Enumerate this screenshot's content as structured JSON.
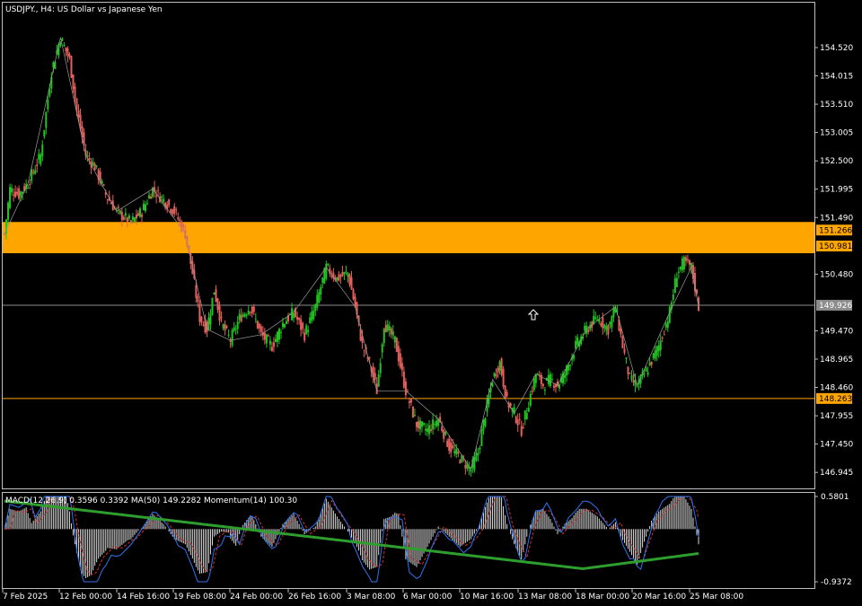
{
  "chart_title": "USDJPY., H4:  US Dollar vs Japanese Yen",
  "indicator_label": "MACD(12,26,9) 0.3596 0.3392 MA(50) 149.2282 Momentum(14) 100.30",
  "colors": {
    "background": "#000000",
    "bull": "#22c322",
    "bear": "#e5605c",
    "zone": "#ffa500",
    "macd_line": "#2f74f0",
    "signal_line": "#d43030",
    "ma_line": "#2e9e2e",
    "hist": "#d8d8d8"
  },
  "price_axis": {
    "ticks": [
      "154.520",
      "154.015",
      "153.510",
      "153.005",
      "152.500",
      "151.995",
      "151.490",
      "150.480",
      "149.470",
      "148.965",
      "148.460",
      "147.955",
      "147.450",
      "146.945"
    ],
    "tick_values": [
      154.52,
      154.015,
      153.51,
      153.005,
      152.5,
      151.995,
      151.49,
      150.48,
      149.47,
      148.965,
      148.46,
      147.955,
      147.45,
      146.945
    ],
    "range": [
      146.66,
      155.32
    ]
  },
  "levels": [
    {
      "label": "151.266",
      "value": 151.266,
      "style": "tag"
    },
    {
      "label": "150.981",
      "value": 150.981,
      "style": "tag"
    },
    {
      "label": "149.926",
      "value": 149.926,
      "style": "current"
    },
    {
      "label": "148.263",
      "value": 148.263,
      "style": "tag-line"
    }
  ],
  "zone": {
    "from": 150.981,
    "to": 151.266
  },
  "indicator_axis": {
    "top_label": "0.5801",
    "bottom_label": "-0.9372"
  },
  "time_axis": [
    "7 Feb 2025",
    "12 Feb 00:00",
    "14 Feb 16:00",
    "19 Feb 08:00",
    "24 Feb 00:00",
    "26 Feb 16:00",
    "3 Mar 08:00",
    "6 Mar 00:00",
    "10 Mar 16:00",
    "13 Mar 08:00",
    "18 Mar 00:00",
    "20 Mar 16:00",
    "25 Mar 08:00"
  ],
  "chart_data": {
    "type": "candlestick",
    "symbol": "USDJPY.",
    "timeframe": "H4",
    "title": "USDJPY., H4:  US Dollar vs Japanese Yen",
    "ylim": [
      146.66,
      155.32
    ],
    "x_tick_labels": [
      "7 Feb 2025",
      "12 Feb 00:00",
      "14 Feb 16:00",
      "19 Feb 08:00",
      "24 Feb 00:00",
      "26 Feb 16:00",
      "3 Mar 08:00",
      "6 Mar 00:00",
      "10 Mar 16:00",
      "13 Mar 08:00",
      "18 Mar 00:00",
      "20 Mar 16:00",
      "25 Mar 08:00"
    ],
    "y_tick_labels": [
      "154.520",
      "154.015",
      "153.510",
      "153.005",
      "152.500",
      "151.995",
      "151.490",
      "150.480",
      "149.470",
      "148.965",
      "148.460",
      "147.955",
      "147.450",
      "146.945"
    ],
    "close_path": [
      [
        0,
        151.2
      ],
      [
        3,
        152.0
      ],
      [
        8,
        151.9
      ],
      [
        13,
        152.1
      ],
      [
        20,
        152.6
      ],
      [
        26,
        154.1
      ],
      [
        31,
        154.7
      ],
      [
        36,
        154.3
      ],
      [
        40,
        153.4
      ],
      [
        45,
        152.6
      ],
      [
        50,
        152.4
      ],
      [
        56,
        151.9
      ],
      [
        62,
        151.6
      ],
      [
        70,
        151.4
      ],
      [
        76,
        151.6
      ],
      [
        82,
        152.0
      ],
      [
        88,
        151.8
      ],
      [
        94,
        151.6
      ],
      [
        100,
        151.2
      ],
      [
        104,
        150.5
      ],
      [
        108,
        149.7
      ],
      [
        112,
        149.5
      ],
      [
        116,
        150.2
      ],
      [
        120,
        149.6
      ],
      [
        125,
        149.3
      ],
      [
        130,
        149.7
      ],
      [
        136,
        149.9
      ],
      [
        142,
        149.4
      ],
      [
        148,
        149.2
      ],
      [
        154,
        149.6
      ],
      [
        160,
        149.8
      ],
      [
        166,
        149.4
      ],
      [
        172,
        149.9
      ],
      [
        178,
        150.6
      ],
      [
        184,
        150.4
      ],
      [
        190,
        150.5
      ],
      [
        194,
        149.9
      ],
      [
        198,
        149.2
      ],
      [
        202,
        148.9
      ],
      [
        206,
        148.4
      ],
      [
        210,
        149.6
      ],
      [
        216,
        149.3
      ],
      [
        222,
        148.4
      ],
      [
        228,
        147.8
      ],
      [
        234,
        147.7
      ],
      [
        240,
        147.9
      ],
      [
        246,
        147.4
      ],
      [
        252,
        147.2
      ],
      [
        258,
        147.0
      ],
      [
        262,
        147.3
      ],
      [
        266,
        148.0
      ],
      [
        270,
        148.6
      ],
      [
        274,
        148.9
      ],
      [
        278,
        148.2
      ],
      [
        282,
        148.0
      ],
      [
        286,
        147.7
      ],
      [
        290,
        148.2
      ],
      [
        294,
        148.7
      ],
      [
        298,
        148.5
      ],
      [
        302,
        148.6
      ],
      [
        306,
        148.5
      ],
      [
        310,
        148.7
      ],
      [
        316,
        149.2
      ],
      [
        322,
        149.5
      ],
      [
        328,
        149.7
      ],
      [
        334,
        149.5
      ],
      [
        338,
        149.9
      ],
      [
        342,
        149.2
      ],
      [
        346,
        148.6
      ],
      [
        350,
        148.5
      ],
      [
        356,
        148.8
      ],
      [
        362,
        149.2
      ],
      [
        368,
        149.8
      ],
      [
        372,
        150.5
      ],
      [
        376,
        150.7
      ],
      [
        380,
        150.6
      ],
      [
        384,
        149.9
      ]
    ],
    "macd": {
      "histogram_last": 0.3596,
      "signal_last": 0.3392,
      "range": [
        -0.9372,
        0.5801
      ]
    },
    "ma50_last": 149.2282,
    "momentum14_last": 100.3
  }
}
